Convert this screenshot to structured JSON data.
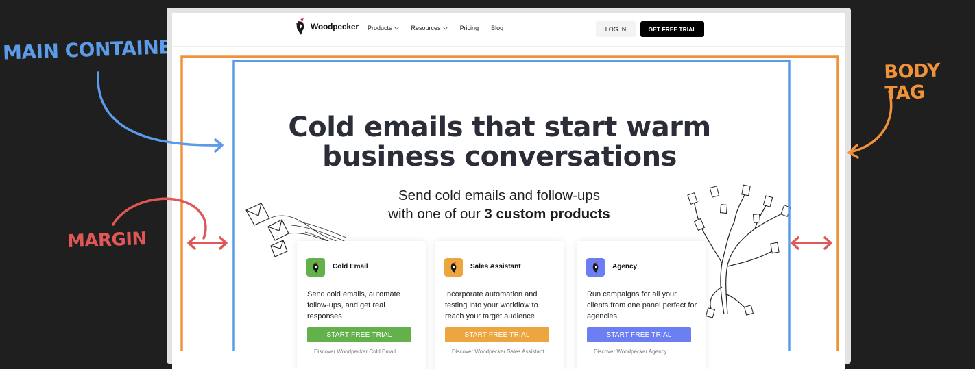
{
  "annotations": {
    "main_container": "MAIN CONTAINER",
    "body_tag": "BODY TAG",
    "margin": "MARGIN",
    "colors": {
      "main_container": "#5b9be8",
      "body_tag": "#f0923a",
      "margin": "#e05757"
    }
  },
  "header": {
    "logo_text": "Woodpecker",
    "menu": [
      {
        "label": "Products",
        "has_dropdown": true
      },
      {
        "label": "Resources",
        "has_dropdown": true
      },
      {
        "label": "Pricing",
        "has_dropdown": false
      },
      {
        "label": "Blog",
        "has_dropdown": false
      }
    ],
    "login_label": "LOG IN",
    "trial_label": "GET FREE TRIAL"
  },
  "hero": {
    "title_line1": "Cold emails that start warm",
    "title_line2": "business conversations",
    "subtitle_line1": "Send cold emails and follow-ups",
    "subtitle_line2_prefix": "with one of our ",
    "subtitle_line2_bold": "3 custom products"
  },
  "products": [
    {
      "name": "Cold Email",
      "desc": "Send cold emails, automate follow-ups, and get real responses",
      "button": "START FREE TRIAL",
      "link": "Discover Woodpecker Cold Email",
      "color": "#62b14b"
    },
    {
      "name": "Sales Assistant",
      "desc": "Incorporate automation and testing into your workflow to reach your target audience",
      "button": "START FREE TRIAL",
      "link": "Discover Woodpecker Sales Assistant",
      "color": "#eca53f"
    },
    {
      "name": "Agency",
      "desc": "Run campaigns for all your clients from one panel perfect for agencies",
      "button": "START FREE TRIAL",
      "link": "Discover Woodpecker Agency",
      "color": "#6b7ff3"
    }
  ]
}
